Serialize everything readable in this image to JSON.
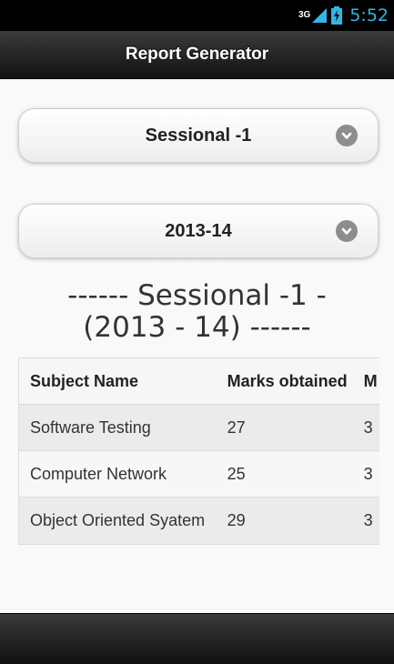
{
  "status_bar": {
    "network": "3G",
    "time": "5:52",
    "accent": "#33b5e5"
  },
  "header": {
    "title": "Report Generator"
  },
  "exam_select": {
    "value": "Sessional -1",
    "icon": "chevron-down-icon"
  },
  "year_select": {
    "value": "2013-14",
    "icon": "chevron-down-icon"
  },
  "report": {
    "title_line1": "------ Sessional -1 -",
    "title_line2": "(2013 - 14) ------"
  },
  "table": {
    "columns": [
      "Subject Name",
      "Marks obtained",
      "M"
    ],
    "rows": [
      {
        "subject": "Software Testing",
        "marks": "27",
        "extra": "3"
      },
      {
        "subject": "Computer Network",
        "marks": "25",
        "extra": "3"
      },
      {
        "subject": "Object Oriented Syatem",
        "marks": "29",
        "extra": "3"
      }
    ]
  }
}
